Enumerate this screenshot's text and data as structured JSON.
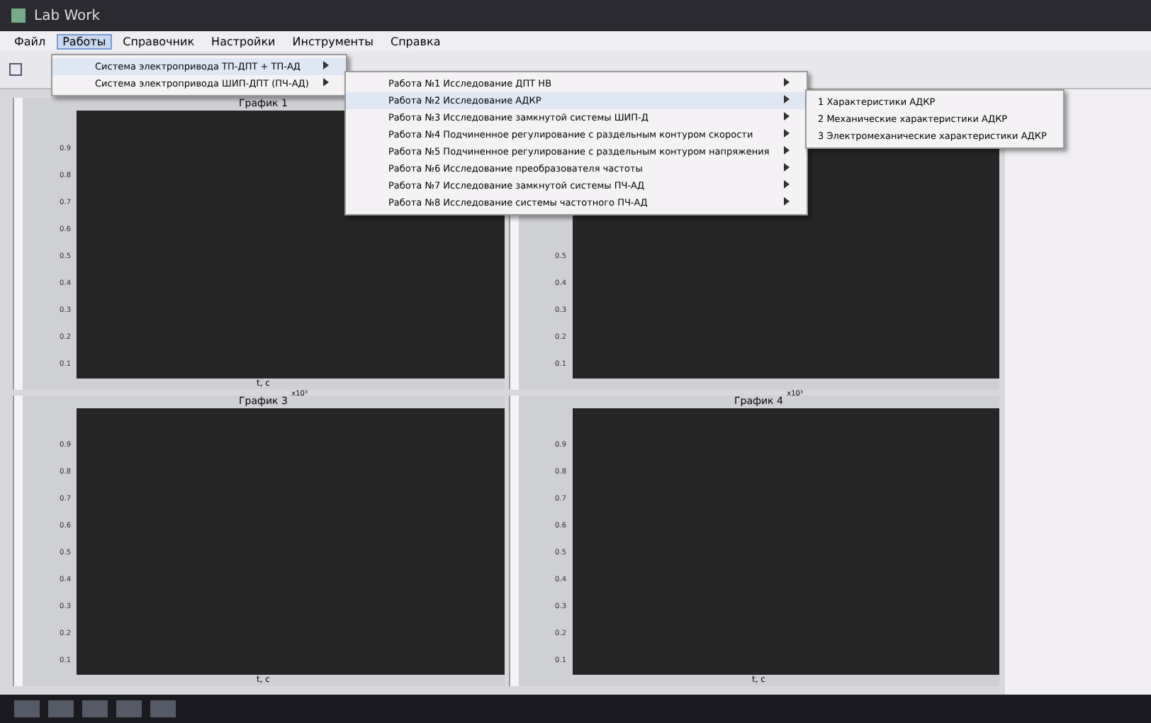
{
  "window": {
    "title": "Lab Work"
  },
  "menu_bar": [
    {
      "label": "Файл",
      "selected": false
    },
    {
      "label": "Работы",
      "selected": true
    },
    {
      "label": "Справочник",
      "selected": false
    },
    {
      "label": "Настройки",
      "selected": false
    },
    {
      "label": "Инструменты",
      "selected": false
    },
    {
      "label": "Справка",
      "selected": false
    }
  ],
  "dropdown": [
    {
      "label": "Система электропривода ТП-ДПТ + ТП-АД",
      "selected": true
    },
    {
      "label": "Система электропривода ШИП-ДПТ (ПЧ-АД)",
      "selected": false
    }
  ],
  "submenu": [
    {
      "label": "Работа №1 Исследование ДПТ НВ",
      "selected": false
    },
    {
      "label": "Работа №2 Исследование АДКР",
      "selected": true
    },
    {
      "label": "Работа №3 Исследование замкнутой системы ШИП-Д",
      "selected": false
    },
    {
      "label": "Работа №4 Подчиненное регулирование с раздельным контуром скорости",
      "selected": false
    },
    {
      "label": "Работа №5 Подчиненное регулирование с раздельным контуром напряжения",
      "selected": false
    },
    {
      "label": "Работа №6 Исследование преобразователя частоты",
      "selected": false
    },
    {
      "label": "Работа №7 Исследование замкнутой системы ПЧ-АД",
      "selected": false
    },
    {
      "label": "Работа №8 Исследование системы частотного ПЧ-АД",
      "selected": false
    }
  ],
  "sub_submenu": [
    "1 Характеристики АДКР",
    "2 Механические характеристики АДКР",
    "3 Электромеханические характеристики АДКР"
  ],
  "plots": [
    {
      "title": "График 1",
      "yticks": [
        "0.9",
        "0.8",
        "0.7",
        "0.6",
        "0.5",
        "0.4",
        "0.3",
        "0.2",
        "0.1"
      ],
      "xlabel": "t, c"
    },
    {
      "yticks": [
        "0.5",
        "0.4",
        "0.3",
        "0.2",
        "0.1"
      ]
    },
    {
      "title": "График 3",
      "exponent": "x10³",
      "yticks": [
        "0.9",
        "0.8",
        "0.7",
        "0.6",
        "0.5",
        "0.4",
        "0.3",
        "0.2",
        "0.1"
      ],
      "xlabel": "t, c"
    },
    {
      "title": "График 4",
      "exponent": "x10³",
      "yticks": [
        "0.9",
        "0.8",
        "0.7",
        "0.6",
        "0.5",
        "0.4",
        "0.3",
        "0.2",
        "0.1"
      ],
      "xlabel": "t, c"
    }
  ]
}
